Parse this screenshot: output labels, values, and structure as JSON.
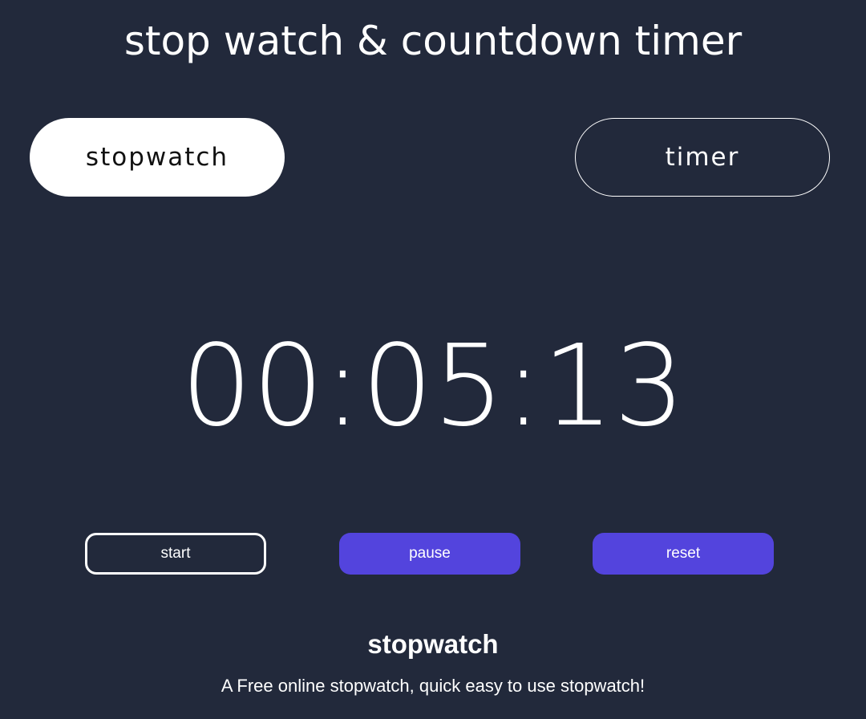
{
  "title": "stop watch & countdown timer",
  "tabs": [
    {
      "label": "stopwatch",
      "active": true
    },
    {
      "label": "timer",
      "active": false
    }
  ],
  "display": "00:05:13",
  "buttons": {
    "start": "start",
    "pause": "pause",
    "reset": "reset"
  },
  "footer": {
    "heading": "stopwatch",
    "description": "A Free online stopwatch, quick easy to use stopwatch!"
  },
  "colors": {
    "background": "#22293b",
    "accent": "#5344dd"
  }
}
